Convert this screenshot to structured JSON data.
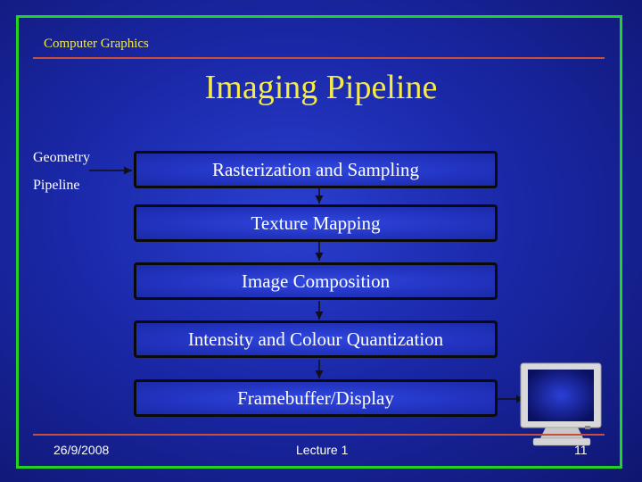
{
  "header": {
    "text": "Computer Graphics"
  },
  "title": "Imaging Pipeline",
  "side_label": {
    "line1": "Geometry",
    "line2": "Pipeline"
  },
  "stages": [
    "Rasterization and Sampling",
    "Texture Mapping",
    "Image Composition",
    "Intensity and Colour Quantization",
    "Framebuffer/Display"
  ],
  "footer": {
    "date": "26/9/2008",
    "center": "Lecture 1",
    "page": "11"
  },
  "monitor_icon": "crt-monitor-icon",
  "colors": {
    "background": "#1a28a8",
    "frame": "#23d323",
    "title": "#f5ea4a",
    "rule": "#c8503a"
  }
}
